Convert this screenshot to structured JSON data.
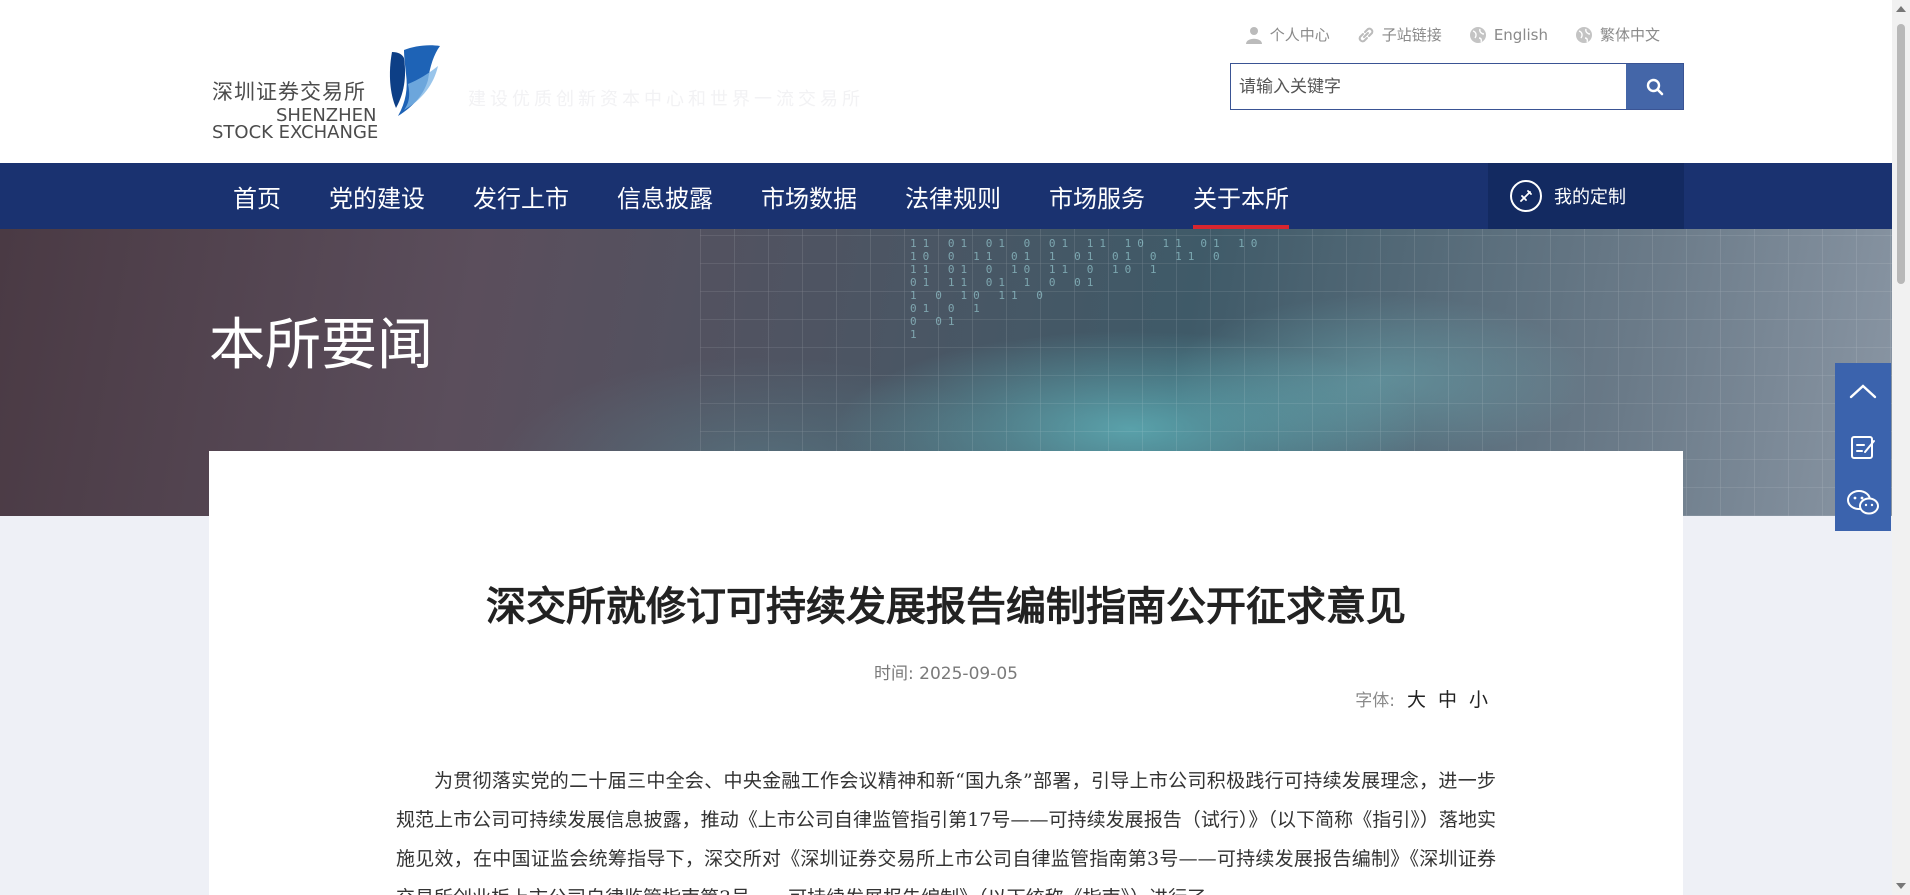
{
  "header": {
    "logo": {
      "cn": "深圳证券交易所",
      "en_line1": "SHENZHEN",
      "en_line2": "STOCK EXCHANGE"
    },
    "slogan": "建设优质创新资本中心和世界一流交易所",
    "toplinks": [
      {
        "label": "个人中心",
        "icon": "user-icon"
      },
      {
        "label": "子站链接",
        "icon": "link-icon"
      },
      {
        "label": "English",
        "icon": "globe-icon"
      },
      {
        "label": "繁体中文",
        "icon": "globe-icon"
      }
    ],
    "search": {
      "placeholder": "请输入关键字",
      "value": ""
    }
  },
  "nav": {
    "items": [
      {
        "label": "首页"
      },
      {
        "label": "党的建设"
      },
      {
        "label": "发行上市"
      },
      {
        "label": "信息披露"
      },
      {
        "label": "市场数据"
      },
      {
        "label": "法律规则"
      },
      {
        "label": "市场服务"
      },
      {
        "label": "关于本所",
        "active": true
      }
    ],
    "custom_label": "我的定制"
  },
  "banner": {
    "title": "本所要闻"
  },
  "article": {
    "title": "深交所就修订可持续发展报告编制指南公开征求意见",
    "date_label": "时间:",
    "date": "2025-09-05",
    "font_label": "字体:",
    "font_options": [
      "大",
      "中",
      "小"
    ],
    "body": "为贯彻落实党的二十届三中全会、中央金融工作会议精神和新“国九条”部署，引导上市公司积极践行可持续发展理念，进一步规范上市公司可持续发展信息披露，推动《上市公司自律监管指引第17号——可持续发展报告（试行）》（以下简称《指引》）落地实施见效，在中国证监会统筹指导下，深交所对《深圳证券交易所上市公司自律监管指南第3号——可持续发展报告编制》《深圳证券交易所创业板上市公司自律监管指南第3号——可持续发展报告编制》（以下统称《指南》）进行了"
  },
  "side_tools": [
    {
      "icon": "back-to-top-icon"
    },
    {
      "icon": "feedback-icon"
    },
    {
      "icon": "wechat-icon"
    }
  ],
  "colors": {
    "nav_bg": "#1a3270",
    "accent": "#d8262f",
    "search_btn": "#4466a8",
    "side_bg": "#3b63ad"
  }
}
